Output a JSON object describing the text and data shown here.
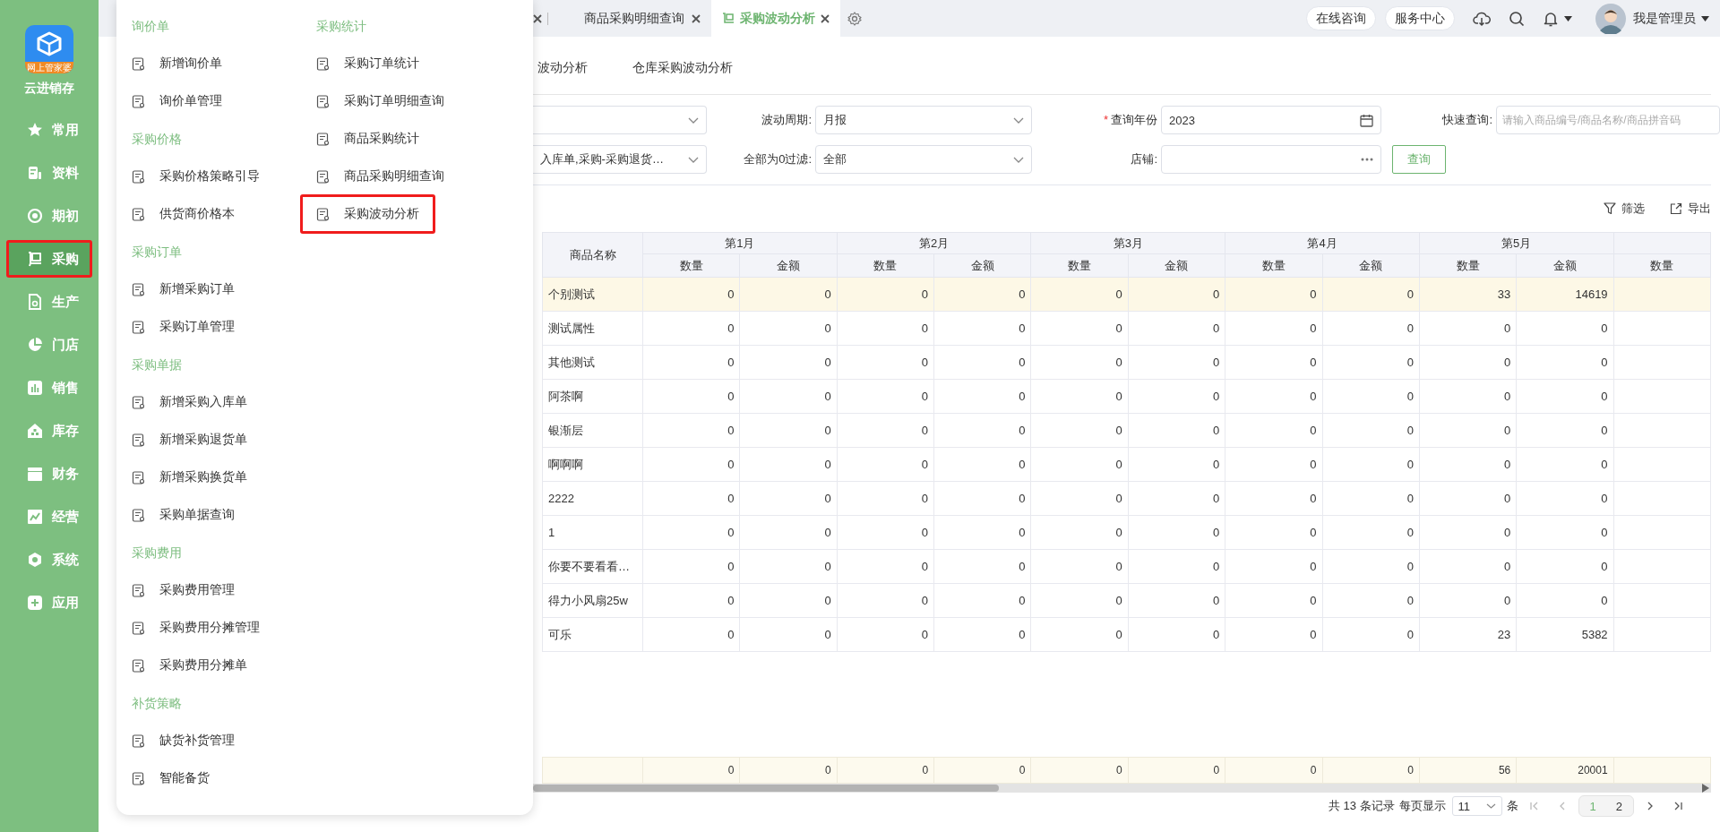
{
  "sidebar": {
    "logo_label": "网上管家婆",
    "app_name": "云进销存",
    "items": [
      {
        "label": "常用",
        "kind": "star",
        "selected": false
      },
      {
        "label": "资料",
        "kind": "doc",
        "selected": false
      },
      {
        "label": "期初",
        "kind": "target",
        "selected": false
      },
      {
        "label": "采购",
        "kind": "cart",
        "selected": true
      },
      {
        "label": "生产",
        "kind": "file",
        "selected": false
      },
      {
        "label": "门店",
        "kind": "pie",
        "selected": false
      },
      {
        "label": "销售",
        "kind": "bars",
        "selected": false
      },
      {
        "label": "库存",
        "kind": "house",
        "selected": false
      },
      {
        "label": "财务",
        "kind": "wallet",
        "selected": false
      },
      {
        "label": "经营",
        "kind": "trend",
        "selected": false
      },
      {
        "label": "系统",
        "kind": "hexagon",
        "selected": false
      },
      {
        "label": "应用",
        "kind": "plus",
        "selected": false
      }
    ]
  },
  "menu": {
    "columns": [
      {
        "groups": [
          {
            "title": "询价单",
            "items": [
              {
                "label": "新增询价单",
                "highlighted": false
              },
              {
                "label": "询价单管理",
                "highlighted": false
              }
            ]
          },
          {
            "title": "采购价格",
            "items": [
              {
                "label": "采购价格策略引导",
                "highlighted": false
              },
              {
                "label": "供货商价格本",
                "highlighted": false
              }
            ]
          },
          {
            "title": "采购订单",
            "items": [
              {
                "label": "新增采购订单",
                "highlighted": false
              },
              {
                "label": "采购订单管理",
                "highlighted": false
              }
            ]
          },
          {
            "title": "采购单据",
            "items": [
              {
                "label": "新增采购入库单",
                "highlighted": false
              },
              {
                "label": "新增采购退货单",
                "highlighted": false
              },
              {
                "label": "新增采购换货单",
                "highlighted": false
              },
              {
                "label": "采购单据查询",
                "highlighted": false
              }
            ]
          },
          {
            "title": "采购费用",
            "items": [
              {
                "label": "采购费用管理",
                "highlighted": false
              },
              {
                "label": "采购费用分摊管理",
                "highlighted": false
              },
              {
                "label": "采购费用分摊单",
                "highlighted": false
              }
            ]
          },
          {
            "title": "补货策略",
            "items": [
              {
                "label": "缺货补货管理",
                "highlighted": false
              },
              {
                "label": "智能备货",
                "highlighted": false
              }
            ]
          }
        ]
      },
      {
        "groups": [
          {
            "title": "采购统计",
            "items": [
              {
                "label": "采购订单统计",
                "highlighted": false
              },
              {
                "label": "采购订单明细查询",
                "highlighted": false
              },
              {
                "label": "商品采购统计",
                "highlighted": false
              },
              {
                "label": "商品采购明细查询",
                "highlighted": false
              },
              {
                "label": "采购波动分析",
                "highlighted": true
              }
            ]
          }
        ]
      }
    ]
  },
  "topbar": {
    "tabs": [
      {
        "label": "商品采购明细查询",
        "selected": false
      },
      {
        "label": "采购波动分析",
        "selected": true
      }
    ],
    "buttons": [
      "在线咨询",
      "服务中心"
    ],
    "user": "我是管理员"
  },
  "subtabs": [
    {
      "label": "波动分析",
      "selected": false
    },
    {
      "label": "仓库采购波动分析",
      "selected": false
    }
  ],
  "filter_rows": [
    [
      {
        "kind": "select"
      },
      {
        "kind": "select",
        "label": "波动周期:",
        "value": "月报"
      },
      {
        "kind": "date",
        "label": "查询年份",
        "required_mark": "*",
        "value": "2023"
      },
      {
        "kind": "text",
        "label": "快速查询:",
        "placeholder": "请输入商品编号/商品名称/商品拼音码"
      }
    ],
    [
      {
        "kind": "select",
        "value": "入库单,采购-采购退货…"
      },
      {
        "kind": "select",
        "label": "全部为0过滤:",
        "value": "全部"
      },
      {
        "kind": "picker",
        "label": "店铺:"
      },
      {
        "kind": "button",
        "label": "查询"
      }
    ]
  ],
  "toolbar": [
    {
      "label": "筛选",
      "kind": "filter"
    },
    {
      "label": "导出",
      "kind": "export"
    }
  ],
  "table": {
    "name_header": "商品名称",
    "groups": [
      {
        "title": "第1月",
        "columns": [
          "数量",
          "金额"
        ]
      },
      {
        "title": "第2月",
        "columns": [
          "数量",
          "金额"
        ]
      },
      {
        "title": "第3月",
        "columns": [
          "数量",
          "金额"
        ]
      },
      {
        "title": "第4月",
        "columns": [
          "数量",
          "金额"
        ]
      },
      {
        "title": "第5月",
        "columns": [
          "数量",
          "金额"
        ]
      },
      {
        "columns": [
          "数量"
        ]
      }
    ],
    "rows": [
      {
        "name": "个别测试",
        "selected": true,
        "values": [
          "0",
          "0",
          "0",
          "0",
          "0",
          "0",
          "0",
          "0",
          "33",
          "14619"
        ]
      },
      {
        "name": "测试属性",
        "selected": false,
        "values": [
          "0",
          "0",
          "0",
          "0",
          "0",
          "0",
          "0",
          "0",
          "0",
          "0"
        ]
      },
      {
        "name": "其他测试",
        "selected": false,
        "values": [
          "0",
          "0",
          "0",
          "0",
          "0",
          "0",
          "0",
          "0",
          "0",
          "0"
        ]
      },
      {
        "name": "阿茶啊",
        "selected": false,
        "values": [
          "0",
          "0",
          "0",
          "0",
          "0",
          "0",
          "0",
          "0",
          "0",
          "0"
        ]
      },
      {
        "name": "银渐层",
        "selected": false,
        "values": [
          "0",
          "0",
          "0",
          "0",
          "0",
          "0",
          "0",
          "0",
          "0",
          "0"
        ]
      },
      {
        "name": "啊啊啊",
        "selected": false,
        "values": [
          "0",
          "0",
          "0",
          "0",
          "0",
          "0",
          "0",
          "0",
          "0",
          "0"
        ]
      },
      {
        "name": "2222",
        "selected": false,
        "values": [
          "0",
          "0",
          "0",
          "0",
          "0",
          "0",
          "0",
          "0",
          "0",
          "0"
        ]
      },
      {
        "name": "1",
        "selected": false,
        "values": [
          "0",
          "0",
          "0",
          "0",
          "0",
          "0",
          "0",
          "0",
          "0",
          "0"
        ]
      },
      {
        "name": "你要不要看看…",
        "selected": false,
        "values": [
          "0",
          "0",
          "0",
          "0",
          "0",
          "0",
          "0",
          "0",
          "0",
          "0"
        ]
      },
      {
        "name": "得力小风扇25w",
        "selected": false,
        "values": [
          "0",
          "0",
          "0",
          "0",
          "0",
          "0",
          "0",
          "0",
          "0",
          "0"
        ]
      },
      {
        "name": "可乐",
        "selected": false,
        "values": [
          "0",
          "0",
          "0",
          "0",
          "0",
          "0",
          "0",
          "0",
          "23",
          "5382"
        ]
      }
    ],
    "totals": [
      "0",
      "0",
      "0",
      "0",
      "0",
      "0",
      "0",
      "0",
      "56",
      "20001"
    ]
  },
  "pagination": {
    "summary": "共 13 条记录",
    "per_page_label": "每页显示",
    "per_page": "11",
    "unit": "条",
    "pages": [
      {
        "label": "1",
        "selected": true
      },
      {
        "label": "2",
        "selected": false
      }
    ]
  }
}
